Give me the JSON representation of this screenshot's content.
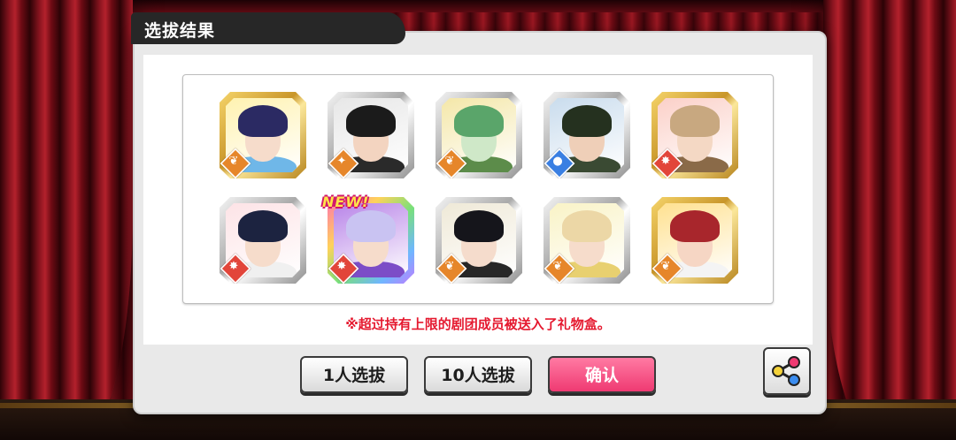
{
  "dialog": {
    "title": "选拔结果",
    "notice": "※超过持有上限的剧团成员被送入了礼物盒。"
  },
  "buttons": {
    "scout_1": "1人选拔",
    "scout_10": "10人选拔",
    "confirm": "确认",
    "share_icon": "share-icon"
  },
  "colors": {
    "confirm": "#ef3a72",
    "notice_text": "#e5192f",
    "title_bar": "#272727"
  },
  "cards": [
    {
      "rarity": "gold",
      "hair": "#2b2a63",
      "skin": "#f6dccb",
      "outfit": "#6fb7e8",
      "bg": "#fff2b0",
      "attr": "orange",
      "attr_icon": "leaf-icon",
      "is_new": false
    },
    {
      "rarity": "silver",
      "hair": "#1b1b1b",
      "skin": "#f3d4c0",
      "outfit": "#2a2a2a",
      "bg": "#e7e7e7",
      "attr": "orange",
      "attr_icon": "star-icon",
      "is_new": false
    },
    {
      "rarity": "silver",
      "hair": "#5aa56a",
      "skin": "#cfe8c8",
      "outfit": "#5c8c4a",
      "bg": "#f4e7a8",
      "attr": "orange",
      "attr_icon": "leaf-icon",
      "is_new": false
    },
    {
      "rarity": "silver",
      "hair": "#25311f",
      "skin": "#efcfb8",
      "outfit": "#3a4a33",
      "bg": "#c9dced",
      "attr": "blue",
      "attr_icon": "drop-icon",
      "is_new": false
    },
    {
      "rarity": "gold",
      "hair": "#c8a880",
      "skin": "#f4d8c4",
      "outfit": "#8a6a48",
      "bg": "#fbd0c8",
      "attr": "red",
      "attr_icon": "flame-icon",
      "is_new": false
    },
    {
      "rarity": "silver",
      "hair": "#1c2340",
      "skin": "#f6dccb",
      "outfit": "#f0f0f0",
      "bg": "#fde3e6",
      "attr": "red",
      "attr_icon": "flame-icon",
      "is_new": false
    },
    {
      "rarity": "rainbow",
      "hair": "#c9c3f2",
      "skin": "#f6dccb",
      "outfit": "#7c4dc7",
      "bg": "#b884e8",
      "attr": "red",
      "attr_icon": "flame-icon",
      "is_new": true,
      "new_label": "NEW!"
    },
    {
      "rarity": "silver",
      "hair": "#15151b",
      "skin": "#f5dccc",
      "outfit": "#272727",
      "bg": "#efe9d7",
      "attr": "orange",
      "attr_icon": "leaf-icon",
      "is_new": false
    },
    {
      "rarity": "silver",
      "hair": "#ecd7a6",
      "skin": "#f6dccb",
      "outfit": "#e8d070",
      "bg": "#f9f3c6",
      "attr": "orange",
      "attr_icon": "leaf-icon",
      "is_new": false
    },
    {
      "rarity": "gold",
      "hair": "#a8262c",
      "skin": "#f6d6c4",
      "outfit": "#f4f4f4",
      "bg": "#ffe190",
      "attr": "orange",
      "attr_icon": "leaf-icon",
      "is_new": false
    }
  ]
}
